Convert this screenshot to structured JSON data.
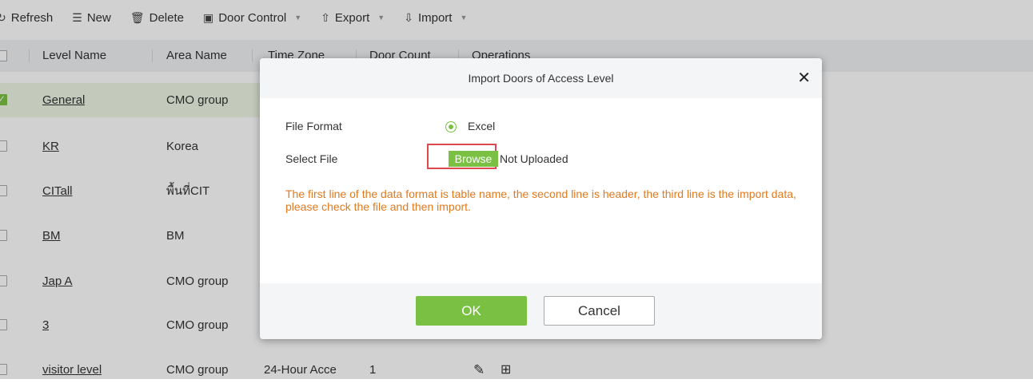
{
  "toolbar": {
    "refresh": {
      "icon": "refresh-icon",
      "label": "Refresh"
    },
    "new": {
      "icon": "new-icon",
      "label": "New"
    },
    "delete": {
      "icon": "trash-icon",
      "label": "Delete"
    },
    "door_control": {
      "icon": "monitor-icon",
      "label": "Door Control"
    },
    "export": {
      "icon": "upload-icon",
      "label": "Export"
    },
    "import": {
      "icon": "download-icon",
      "label": "Import"
    }
  },
  "table": {
    "headers": [
      "Level Name",
      "Area Name",
      "Time Zone",
      "Door Count",
      "Operations"
    ],
    "rows": [
      {
        "level": "General",
        "area": "CMO group",
        "checked": true
      },
      {
        "level": "KR",
        "area": "Korea",
        "checked": false
      },
      {
        "level": "CITall",
        "area": "พื้นที่CIT",
        "checked": false
      },
      {
        "level": "BM",
        "area": "BM",
        "checked": false
      },
      {
        "level": "Jap A",
        "area": "CMO group",
        "checked": false
      },
      {
        "level": "3",
        "area": "CMO group",
        "checked": false
      },
      {
        "level": "visitor level",
        "area": "CMO group",
        "timezone": "24-Hour Acce",
        "doors": "1",
        "checked": false
      }
    ]
  },
  "dialog": {
    "title": "Import Doors of Access Level",
    "close_icon": "close-icon",
    "file_format_label": "File Format",
    "file_format_value": "Excel",
    "select_file_label": "Select File",
    "browse_label": "Browse",
    "upload_status": "Not Uploaded",
    "hint": "The first line of the data format is table name, the second line is header, the third line is the import data, please check the file and then import.",
    "ok_label": "OK",
    "cancel_label": "Cancel"
  },
  "colors": {
    "accent": "#7ac143",
    "hint": "#e07a1f",
    "highlight_frame": "#e0484f",
    "header_bg": "#f0f2f5",
    "selected_row": "#eef7e6"
  }
}
